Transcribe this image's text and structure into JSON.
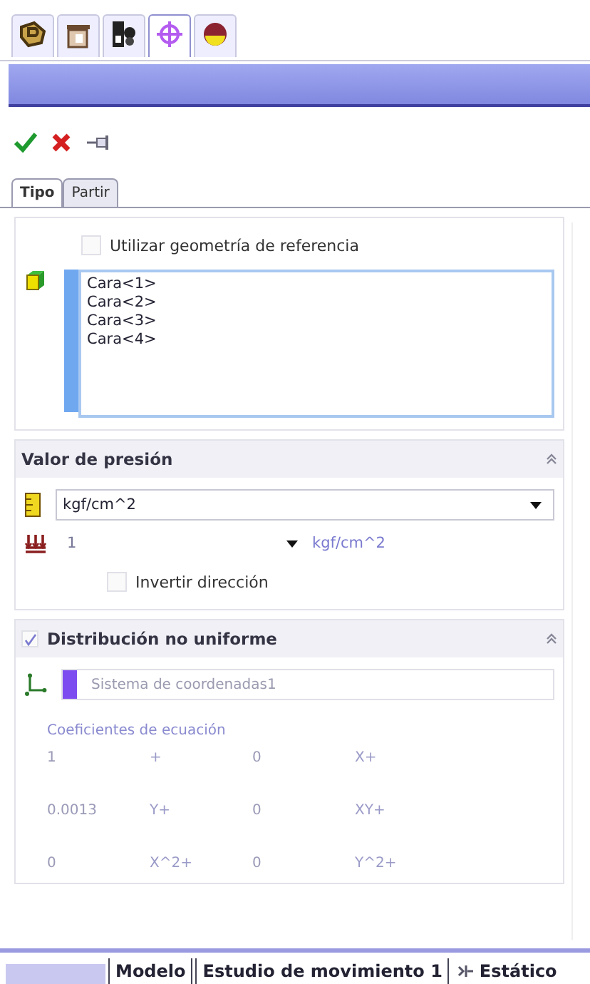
{
  "toolbar": {
    "tabs": [
      {
        "kind": "feature",
        "selected": false
      },
      {
        "kind": "property",
        "selected": false
      },
      {
        "kind": "config",
        "selected": false
      },
      {
        "kind": "target",
        "selected": true
      },
      {
        "kind": "appearance",
        "selected": false
      }
    ]
  },
  "tabs": [
    {
      "label": "Tipo",
      "selected": true
    },
    {
      "label": "Partir",
      "selected": false
    }
  ],
  "selection": {
    "checkbox": {
      "label": "Utilizar geometría de referencia",
      "checked": false
    },
    "items": [
      "Cara<1>",
      "Cara<2>",
      "Cara<3>",
      "Cara<4>"
    ]
  },
  "pressure": {
    "title": "Valor de presión",
    "unit": "kgf/cm^2",
    "value": "1",
    "value_unit": "kgf/cm^2",
    "invert": {
      "label": "Invertir dirección",
      "checked": false
    }
  },
  "distribution": {
    "title": "Distribución no uniforme",
    "checked": true,
    "coord_system": "Sistema de coordenadas1",
    "coef_label": "Coeficientes de ecuación",
    "coefficients": [
      [
        "1",
        "+",
        "0",
        "X+"
      ],
      [
        "0.0013",
        "Y+",
        "0",
        "XY+"
      ],
      [
        "0",
        "X^2+",
        "0",
        "Y^2+"
      ]
    ]
  },
  "bottom_tabs": [
    {
      "label": "Modelo",
      "selected": false,
      "kind": "plain"
    },
    {
      "label": "Estudio de movimiento 1",
      "selected": false,
      "kind": "plain"
    },
    {
      "label": "Estático",
      "selected": true,
      "kind": "study"
    }
  ]
}
